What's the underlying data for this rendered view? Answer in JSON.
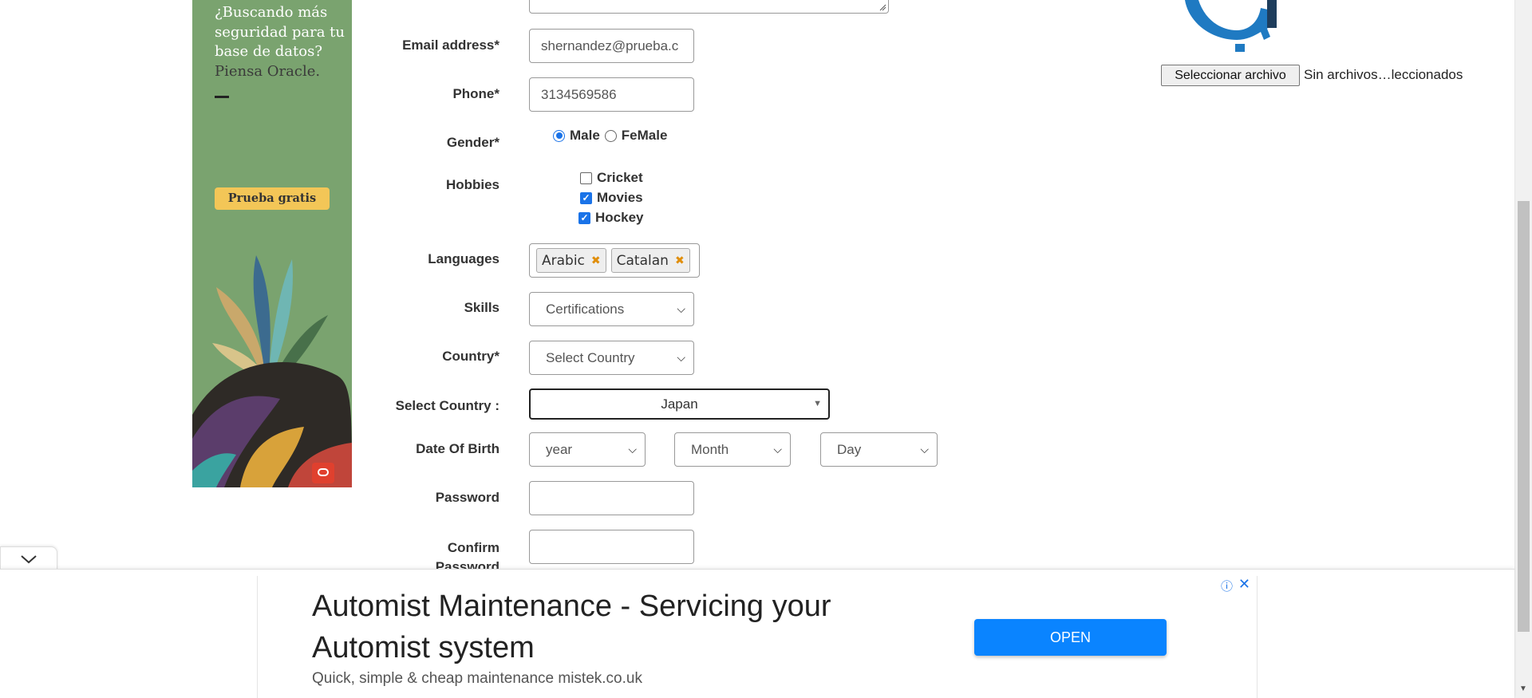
{
  "left_ad": {
    "text_line1": "¿Buscando más seguridad para tu base de datos?",
    "text_line2": "Piensa Oracle.",
    "cta": "Prueba gratis"
  },
  "form": {
    "email": {
      "label": "Email address*",
      "value": "shernandez@prueba.c"
    },
    "phone": {
      "label": "Phone*",
      "value": "3134569586"
    },
    "gender": {
      "label": "Gender*",
      "options": [
        "Male",
        "FeMale"
      ],
      "selected": "Male"
    },
    "hobbies": {
      "label": "Hobbies",
      "items": [
        {
          "label": "Cricket",
          "checked": false
        },
        {
          "label": "Movies",
          "checked": true
        },
        {
          "label": "Hockey",
          "checked": true
        }
      ]
    },
    "languages": {
      "label": "Languages",
      "tags": [
        "Arabic",
        "Catalan"
      ]
    },
    "skills": {
      "label": "Skills",
      "value": "Certifications"
    },
    "country": {
      "label": "Country*",
      "value": "Select Country"
    },
    "select_country": {
      "label": "Select Country :",
      "value": "Japan"
    },
    "dob": {
      "label": "Date Of Birth",
      "year": "year",
      "month": "Month",
      "day": "Day"
    },
    "password": {
      "label": "Password",
      "value": ""
    },
    "confirm_password": {
      "label_line1": "Confirm",
      "label_line2": "Password",
      "value": ""
    }
  },
  "upload": {
    "button": "Seleccionar archivo",
    "status": "Sin archivos…leccionados"
  },
  "bottom_ad": {
    "headline": "Automist Maintenance - Servicing your Automist system",
    "sub": "Quick, simple & cheap maintenance mistek.co.uk",
    "cta": "OPEN"
  },
  "icons": {
    "info": "info-icon",
    "close": "close-icon",
    "collapse": "chevron-down-icon",
    "upload_logo": "gear-icon"
  },
  "colors": {
    "accent": "#1a73e8",
    "ad_button": "#0a84ff",
    "ad_green": "#7aa36f",
    "ad_cta_yellow": "#f3c657"
  }
}
